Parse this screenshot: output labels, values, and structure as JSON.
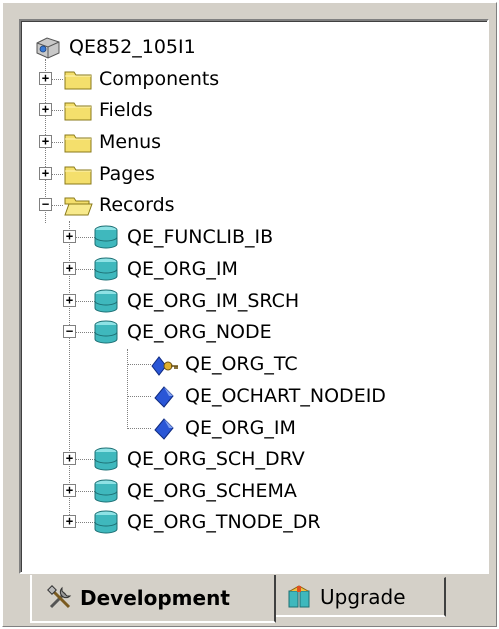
{
  "tree": {
    "root": {
      "label": "QE852_105I1",
      "icon": "project-icon"
    },
    "folders": [
      {
        "label": "Components",
        "state": "collapsed"
      },
      {
        "label": "Fields",
        "state": "collapsed"
      },
      {
        "label": "Menus",
        "state": "collapsed"
      },
      {
        "label": "Pages",
        "state": "collapsed"
      },
      {
        "label": "Records",
        "state": "expanded"
      }
    ],
    "records": [
      {
        "label": "QE_FUNCLIB_IB",
        "state": "collapsed"
      },
      {
        "label": "QE_ORG_IM",
        "state": "collapsed"
      },
      {
        "label": "QE_ORG_IM_SRCH",
        "state": "collapsed"
      },
      {
        "label": "QE_ORG_NODE",
        "state": "expanded"
      },
      {
        "label": "QE_ORG_SCH_DRV",
        "state": "collapsed"
      },
      {
        "label": "QE_ORG_SCHEMA",
        "state": "collapsed"
      },
      {
        "label": "QE_ORG_TNODE_DR",
        "state": "collapsed"
      }
    ],
    "node_fields": [
      {
        "label": "QE_ORG_TC",
        "icon": "key-field-icon"
      },
      {
        "label": "QE_OCHART_NODEID",
        "icon": "field-icon"
      },
      {
        "label": "QE_ORG_IM",
        "icon": "field-icon"
      }
    ]
  },
  "tabs": [
    {
      "label": "Development",
      "active": true,
      "icon": "tools-icon"
    },
    {
      "label": "Upgrade",
      "active": false,
      "icon": "upgrade-icon"
    }
  ],
  "colors": {
    "panel_bg": "#d4d0c8",
    "folder_yellow": "#f4df6c",
    "record_teal": "#3fb8bd",
    "field_blue": "#2a56d6"
  }
}
